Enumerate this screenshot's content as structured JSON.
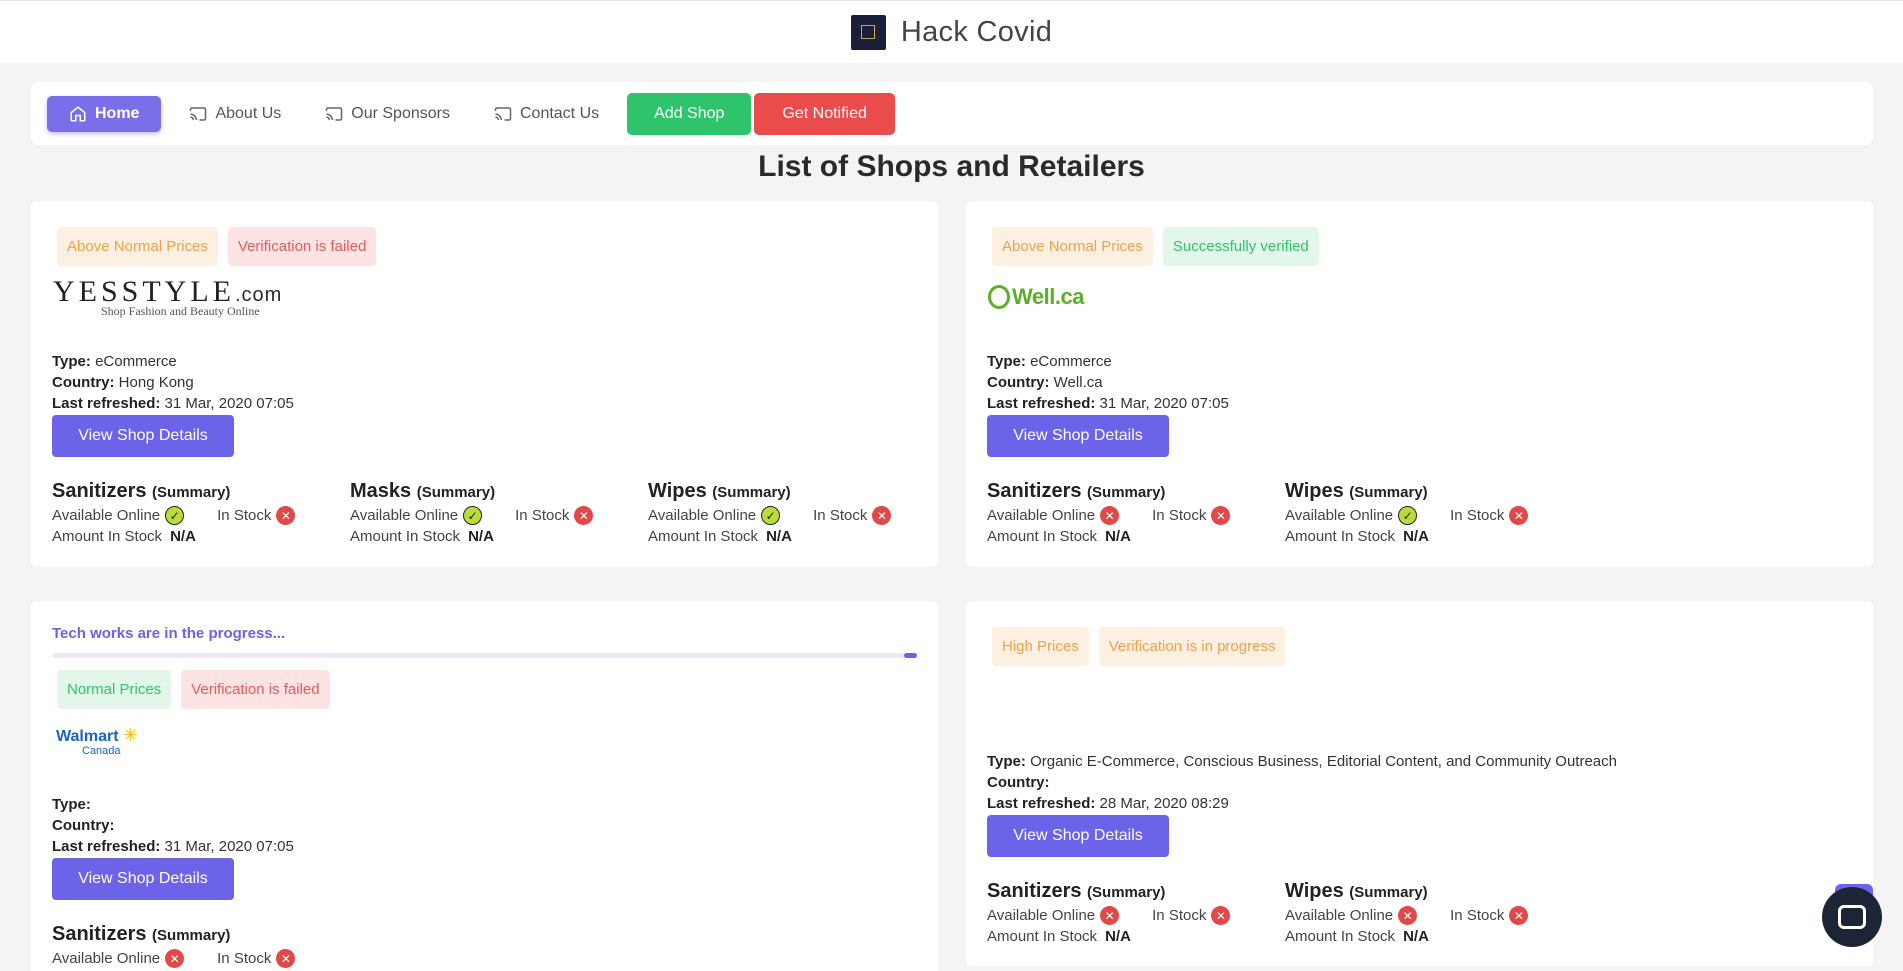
{
  "header": {
    "title": "Hack Covid"
  },
  "nav": {
    "home": "Home",
    "about": "About Us",
    "sponsors": "Our Sponsors",
    "contact": "Contact Us",
    "add_shop": "Add Shop",
    "get_notified": "Get Notified"
  },
  "page_title": "List of Shops and Retailers",
  "labels": {
    "type": "Type:",
    "country": "Country:",
    "last_refreshed": "Last refreshed:",
    "view_details": "View Shop Details",
    "summary": "(Summary)",
    "available_online": "Available Online",
    "in_stock": "In Stock",
    "amount_in_stock": "Amount In Stock",
    "na": "N/A"
  },
  "shops": [
    {
      "price_badge": "Above Normal Prices",
      "verify_badge": "Verification is failed",
      "logo": {
        "main": "YESSTYLE",
        "suffix": ".com",
        "tagline": "Shop Fashion and Beauty Online"
      },
      "type": "eCommerce",
      "country": "Hong Kong",
      "refreshed": "31 Mar, 2020 07:05",
      "products": [
        {
          "name": "Sanitizers",
          "online": "available",
          "stock": "unavailable"
        },
        {
          "name": "Masks",
          "online": "available",
          "stock": "unavailable"
        },
        {
          "name": "Wipes",
          "online": "available",
          "stock": "unavailable"
        }
      ]
    },
    {
      "price_badge": "Above Normal Prices",
      "verify_badge": "Successfully verified",
      "logo": {
        "main": "Well.ca"
      },
      "type": "eCommerce",
      "country": "Well.ca",
      "refreshed": "31 Mar, 2020 07:05",
      "products": [
        {
          "name": "Sanitizers",
          "online": "unavailable",
          "stock": "unavailable"
        },
        {
          "name": "Wipes",
          "online": "available",
          "stock": "unavailable"
        }
      ]
    },
    {
      "progress_text": "Tech works are in the progress...",
      "progress_fraction": 0.985,
      "price_badge": "Normal Prices",
      "verify_badge": "Verification is failed",
      "logo": {
        "main": "Walmart",
        "sub": "Canada"
      },
      "type": "",
      "country": "",
      "refreshed": "31 Mar, 2020 07:05",
      "products": [
        {
          "name": "Sanitizers",
          "online": "unavailable",
          "stock": "unavailable"
        }
      ]
    },
    {
      "price_badge": "High Prices",
      "verify_badge": "Verification is in progress",
      "type": "Organic E-Commerce, Conscious Business, Editorial Content, and Community Outreach",
      "country": "",
      "refreshed": "28 Mar, 2020 08:29",
      "products": [
        {
          "name": "Sanitizers",
          "online": "unavailable",
          "stock": "unavailable"
        },
        {
          "name": "Wipes",
          "online": "unavailable",
          "stock": "unavailable"
        }
      ]
    }
  ],
  "colors": {
    "primary": "#6c63e8",
    "success": "#2ec46b",
    "danger": "#ea4c4c",
    "warning": "#f0a14a"
  }
}
